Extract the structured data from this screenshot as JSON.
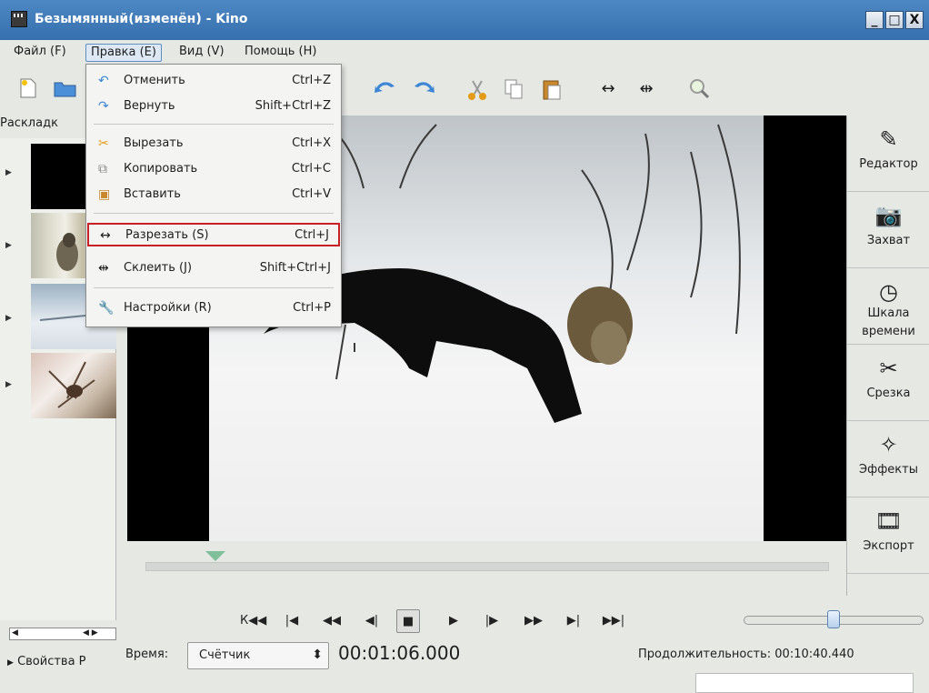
{
  "window": {
    "title": "Безымянный(изменён) - Kino",
    "minimize": "_",
    "maximize": "□",
    "close": "X"
  },
  "menubar": {
    "file": "Файл (F)",
    "edit": "Правка (E)",
    "view": "Вид (V)",
    "help": "Помощь (H)"
  },
  "edit_menu": {
    "items": [
      {
        "icon": "undo-icon",
        "label": "Отменить",
        "shortcut": "Ctrl+Z"
      },
      {
        "icon": "redo-icon",
        "label": "Вернуть",
        "shortcut": "Shift+Ctrl+Z"
      },
      {
        "icon": "cut-icon",
        "label": "Вырезать",
        "shortcut": "Ctrl+X"
      },
      {
        "icon": "copy-icon",
        "label": "Копировать",
        "shortcut": "Ctrl+C"
      },
      {
        "icon": "paste-icon",
        "label": "Вставить",
        "shortcut": "Ctrl+V"
      },
      {
        "icon": "split-scene-icon",
        "label": "Разрезать (S)",
        "shortcut": "Ctrl+J",
        "highlighted": true
      },
      {
        "icon": "join-scenes-icon",
        "label": "Склеить (J)",
        "shortcut": "Shift+Ctrl+J"
      },
      {
        "icon": "preferences-icon",
        "label": "Настройки (R)",
        "shortcut": "Ctrl+P"
      }
    ]
  },
  "storyboard": {
    "label": "Раскладк",
    "properties": "Свойства Р"
  },
  "sidebar": {
    "modes": [
      {
        "label": "Редактор",
        "icon": "editor-icon",
        "active": false
      },
      {
        "label": "Захват",
        "icon": "capture-camera-icon",
        "active": true
      },
      {
        "label": "Шкала времени",
        "icon": "timeline-clock-icon",
        "active": true
      },
      {
        "label": "Срезка",
        "icon": "trim-icon",
        "active": true
      },
      {
        "label": "Эффекты",
        "icon": "effects-sparkle-icon",
        "active": true
      },
      {
        "label": "Экспорт",
        "icon": "export-film-icon",
        "active": true
      }
    ]
  },
  "transport": {
    "buttons": [
      "К◀◀",
      "|◀",
      "◀◀",
      "◀|",
      "■",
      "▶",
      "|▶",
      "▶▶",
      "▶|",
      "▶▶|"
    ]
  },
  "bottom": {
    "time_label": "Время:",
    "counter_value": "Счётчик",
    "timecode": "00:01:06.000",
    "duration": "Продолжительность: 00:10:40.440"
  },
  "position": {
    "playhead_fraction": 0.103,
    "volume_fraction": 0.5
  }
}
